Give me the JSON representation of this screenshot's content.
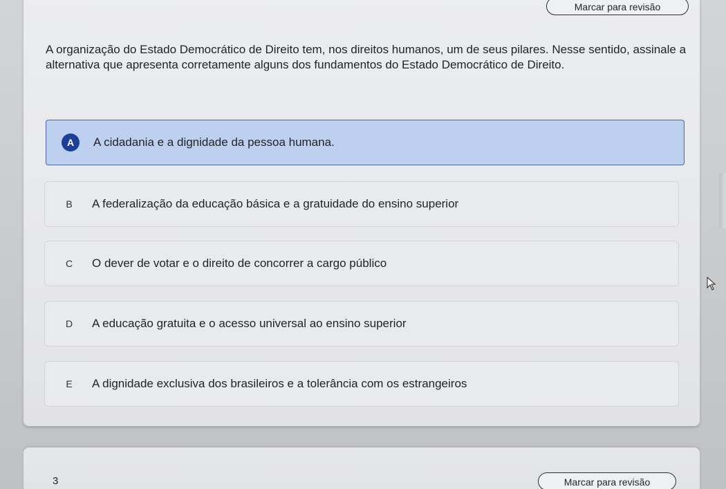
{
  "header": {
    "review_label": "Marcar para revisão"
  },
  "question": {
    "text": "A organização do Estado Democrático de Direito tem, nos direitos humanos, um de seus pilares. Nesse sentido, assinale a alternativa que apresenta corretamente alguns dos fundamentos do Estado Democrático de Direito.",
    "selected": "A",
    "options": [
      {
        "letter": "A",
        "text": "A cidadania e a dignidade da pessoa humana."
      },
      {
        "letter": "B",
        "text": "A federalização da educação básica e a gratuidade do ensino superior"
      },
      {
        "letter": "C",
        "text": "O dever de votar e o direito de concorrer a cargo público"
      },
      {
        "letter": "D",
        "text": "A educação gratuita e o acesso universal ao ensino superior"
      },
      {
        "letter": "E",
        "text": "A dignidade exclusiva dos brasileiros e a tolerância com os estrangeiros"
      }
    ]
  },
  "next_question": {
    "number": "3",
    "review_label": "Marcar para revisão"
  },
  "colors": {
    "selected_bg": "#bed0ef",
    "selected_border": "#4a66a8",
    "selected_badge": "#1e3f95"
  },
  "icons": {
    "cursor": "mouse-pointer-icon"
  }
}
